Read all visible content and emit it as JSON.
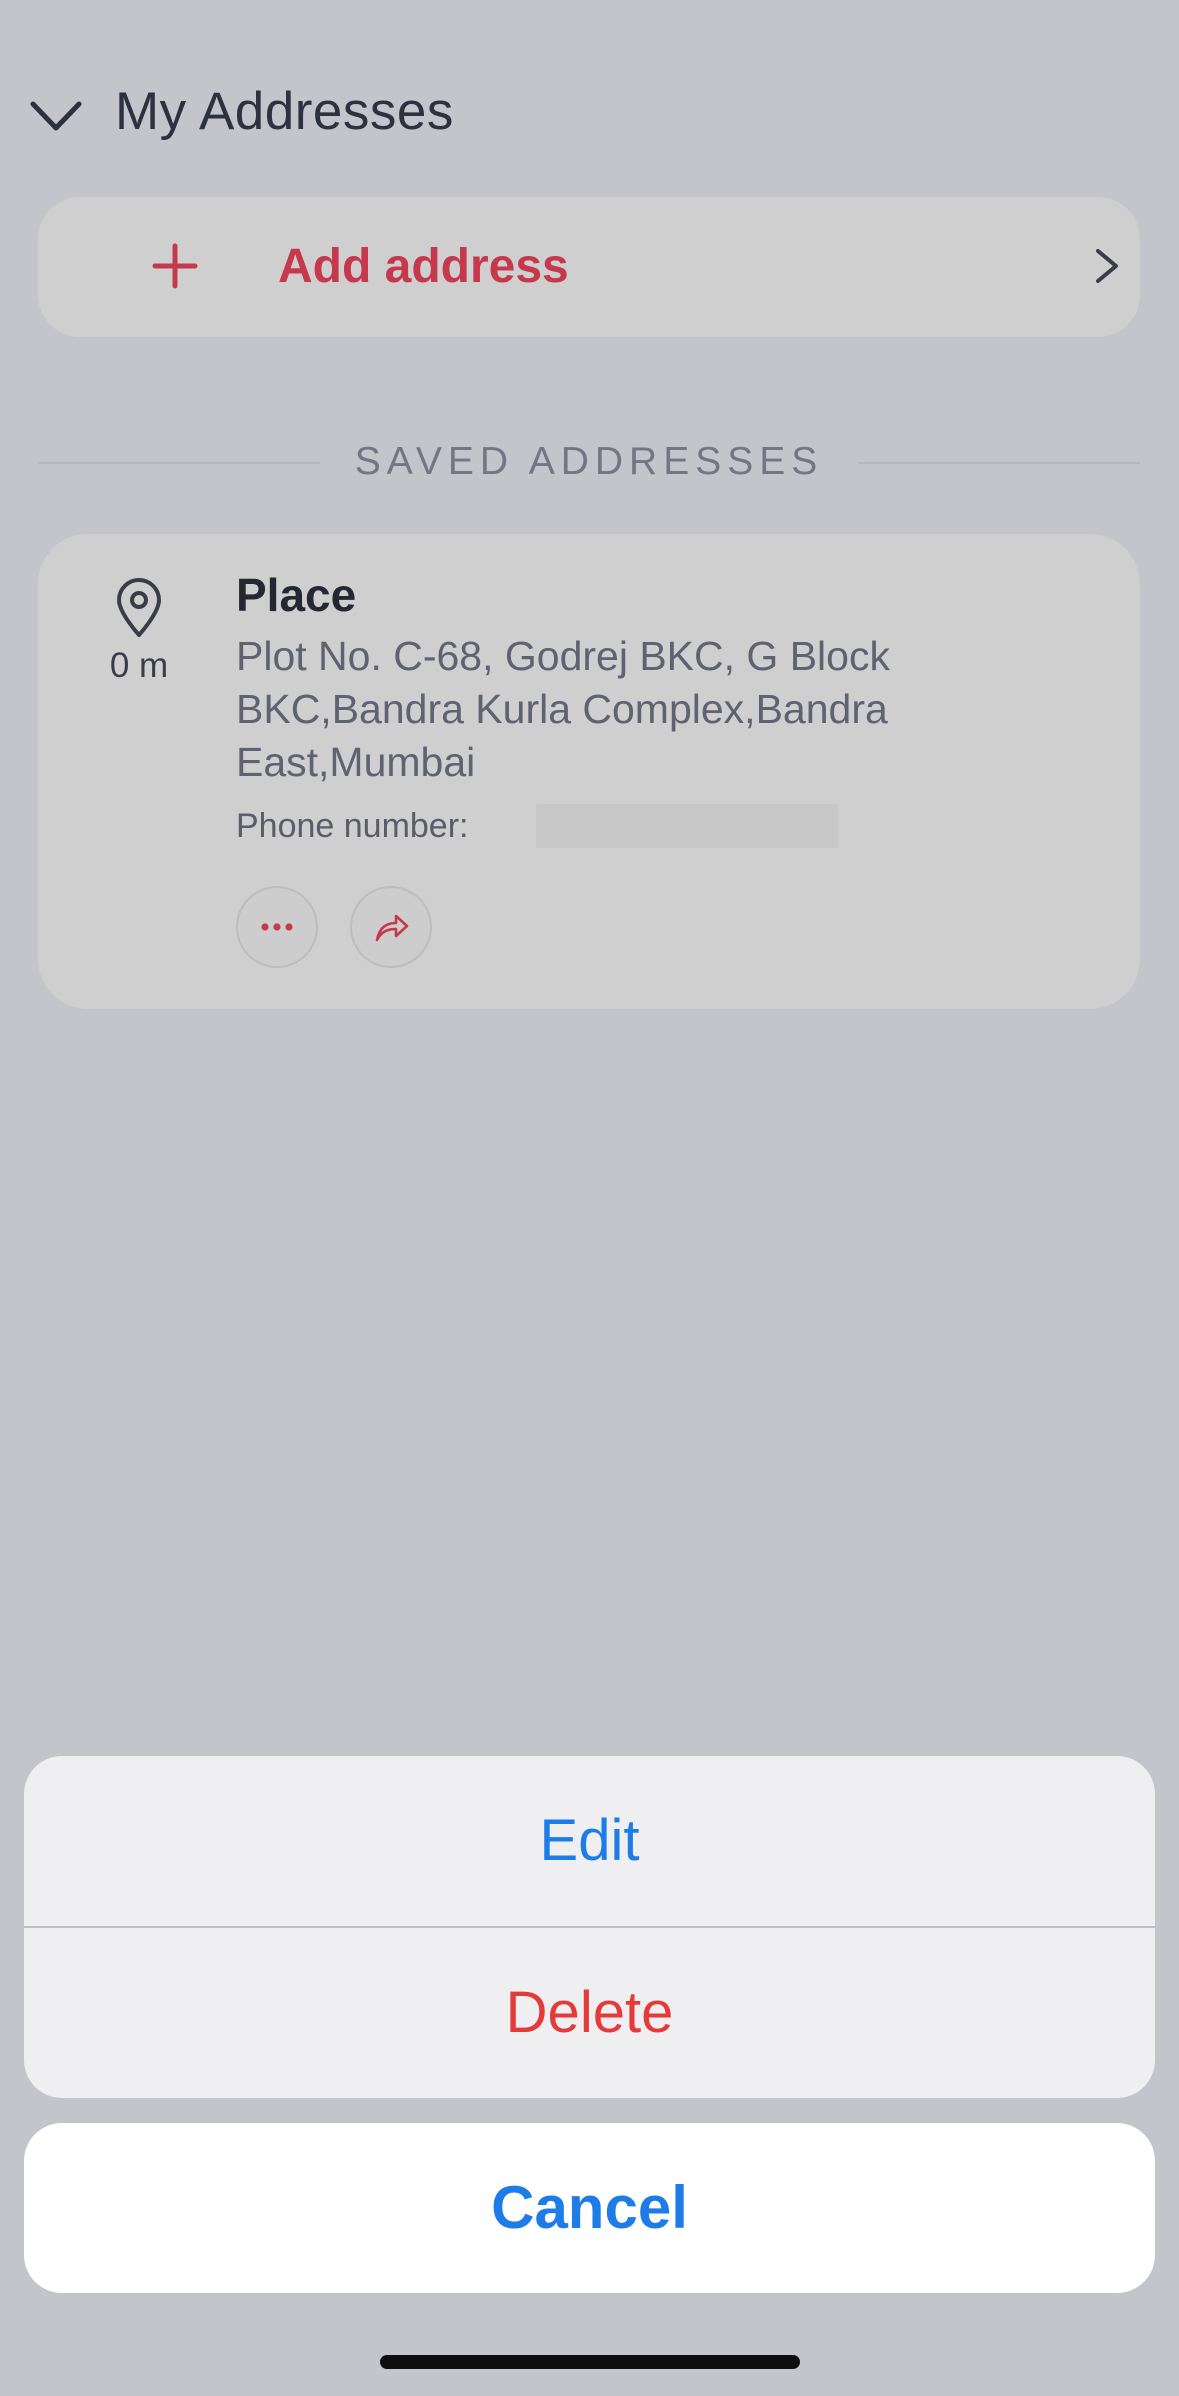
{
  "header": {
    "title": "My Addresses",
    "back_icon": "chevron-down-icon"
  },
  "add_address": {
    "label": "Add address",
    "icon": "plus-icon",
    "trailing_icon": "chevron-right-icon",
    "accent_color": "#c6394d"
  },
  "saved_section": {
    "heading": "SAVED ADDRESSES"
  },
  "saved_addresses": [
    {
      "name": "Place",
      "distance": "0 m",
      "address": "Plot No. C-68, Godrej BKC, G Block BKC,Bandra Kurla Complex,Bandra East,Mumbai",
      "phone_label": "Phone number:",
      "phone_value_redacted": true,
      "icon": "location-pin-icon",
      "actions": [
        {
          "icon": "more-icon"
        },
        {
          "icon": "share-icon"
        }
      ]
    }
  ],
  "action_sheet": {
    "edit_label": "Edit",
    "delete_label": "Delete",
    "cancel_label": "Cancel",
    "edit_color": "#1e7ce8",
    "delete_color": "#e53a3a"
  }
}
